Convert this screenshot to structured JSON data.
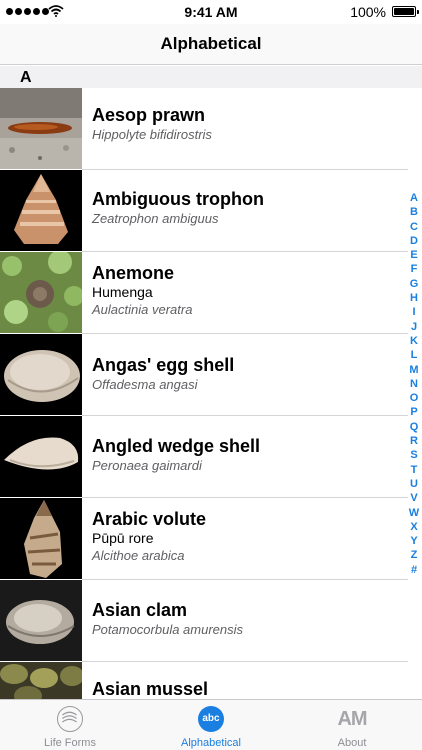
{
  "status_bar": {
    "time": "9:41 AM",
    "battery": "100%",
    "icons": [
      "signal-dots-icon",
      "wifi-icon",
      "battery-icon"
    ]
  },
  "nav": {
    "title": "Alphabetical"
  },
  "section": {
    "letter": "A"
  },
  "rows": [
    {
      "name": "Aesop prawn",
      "common": "",
      "scientific": "Hippolyte bifidirostris"
    },
    {
      "name": "Ambiguous trophon",
      "common": "",
      "scientific": "Zeatrophon ambiguus"
    },
    {
      "name": "Anemone",
      "common": "Humenga",
      "scientific": "Aulactinia veratra"
    },
    {
      "name": "Angas' egg shell",
      "common": "",
      "scientific": "Offadesma angasi"
    },
    {
      "name": "Angled wedge shell",
      "common": "",
      "scientific": "Peronaea gaimardi"
    },
    {
      "name": "Arabic volute",
      "common": "Pūpū rore",
      "scientific": "Alcithoe arabica"
    },
    {
      "name": "Asian clam",
      "common": "",
      "scientific": "Potamocorbula amurensis"
    },
    {
      "name": "Asian mussel",
      "common": "",
      "scientific": ""
    }
  ],
  "index": [
    "A",
    "B",
    "C",
    "D",
    "E",
    "F",
    "G",
    "H",
    "I",
    "J",
    "K",
    "L",
    "M",
    "N",
    "O",
    "P",
    "Q",
    "R",
    "S",
    "T",
    "U",
    "V",
    "W",
    "X",
    "Y",
    "Z",
    "#"
  ],
  "tabs": {
    "life_forms": "Life Forms",
    "alphabetical": "Alphabetical",
    "alphabetical_icon_text": "abc",
    "about": "About",
    "about_icon_text": "AM"
  },
  "colors": {
    "accent": "#1a7fe0",
    "inactive": "#8e8e93"
  }
}
